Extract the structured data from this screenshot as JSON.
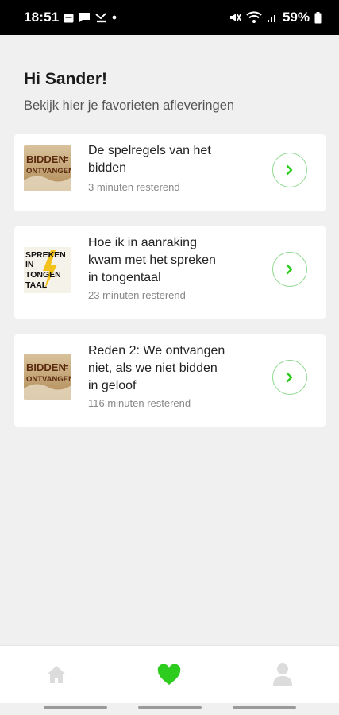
{
  "status_bar": {
    "time": "18:51",
    "battery": "59%"
  },
  "header": {
    "greeting": "Hi Sander!",
    "subtitle": "Bekijk hier je favorieten afleveringen"
  },
  "episodes": [
    {
      "title_lines": [
        "De spelregels van het",
        "bidden"
      ],
      "remaining": "3 minuten resterend",
      "thumbnail": {
        "line1": "BIDDEN",
        "sign": "=",
        "line2": "ONTVANGEN"
      }
    },
    {
      "title_lines": [
        "Hoe ik in aanraking",
        "kwam met het spreken",
        "in tongentaal"
      ],
      "remaining": "23 minuten resterend",
      "thumbnail": {
        "line1": "SPREKEN",
        "line2": "IN",
        "line3": "TONGEN",
        "line4": "TAAL"
      }
    },
    {
      "title_lines": [
        "Reden 2: We ontvangen",
        "niet, als we niet bidden",
        "in geloof"
      ],
      "remaining": "116 minuten resterend",
      "thumbnail": {
        "line1": "BIDDEN",
        "sign": "=",
        "line2": "ONTVANGEN"
      }
    }
  ],
  "colors": {
    "accent": "#2ecc1f",
    "play_border": "#8fd88f",
    "background": "#f0f0f0"
  },
  "bottom_nav": {
    "items": [
      "home-icon",
      "heart-icon",
      "profile-icon"
    ],
    "active": "heart-icon"
  }
}
